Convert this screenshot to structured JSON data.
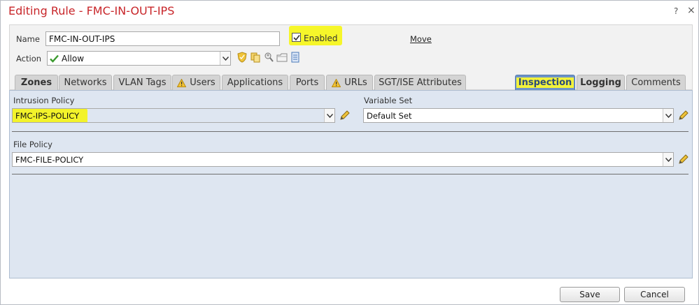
{
  "dialog": {
    "title": "Editing Rule - FMC-IN-OUT-IPS",
    "help_label": "?",
    "close_label": "×"
  },
  "form": {
    "name_label": "Name",
    "name_value": "FMC-IN-OUT-IPS",
    "enabled_label": "Enabled",
    "enabled_checked": true,
    "move_label": "Move",
    "action_label": "Action",
    "action_value": "Allow",
    "action_icons": [
      "shield-icon",
      "copy-icon",
      "search-user-icon",
      "folder-icon",
      "document-icon"
    ]
  },
  "tabs": [
    {
      "label": "Zones",
      "warning": false,
      "bold": true,
      "active": false
    },
    {
      "label": "Networks",
      "warning": false,
      "bold": false,
      "active": false
    },
    {
      "label": "VLAN Tags",
      "warning": false,
      "bold": false,
      "active": false
    },
    {
      "label": "Users",
      "warning": true,
      "bold": false,
      "active": false
    },
    {
      "label": "Applications",
      "warning": false,
      "bold": false,
      "active": false
    },
    {
      "label": "Ports",
      "warning": false,
      "bold": false,
      "active": false
    },
    {
      "label": "URLs",
      "warning": true,
      "bold": false,
      "active": false
    },
    {
      "label": "SGT/ISE Attributes",
      "warning": false,
      "bold": false,
      "active": false
    },
    {
      "label": "Inspection",
      "warning": false,
      "bold": true,
      "active": true
    },
    {
      "label": "Logging",
      "warning": false,
      "bold": true,
      "active": false
    },
    {
      "label": "Comments",
      "warning": false,
      "bold": false,
      "active": false
    }
  ],
  "inspection": {
    "intrusion_policy_label": "Intrusion Policy",
    "intrusion_policy_value": "FMC-IPS-POLICY",
    "variable_set_label": "Variable Set",
    "variable_set_value": "Default Set",
    "file_policy_label": "File Policy",
    "file_policy_value": "FMC-FILE-POLICY"
  },
  "footer": {
    "save_label": "Save",
    "cancel_label": "Cancel"
  },
  "colors": {
    "title": "#c8262a",
    "highlight": "#f3f32a",
    "active_tab": "#6d93c7",
    "content_bg": "#dee6f1"
  }
}
